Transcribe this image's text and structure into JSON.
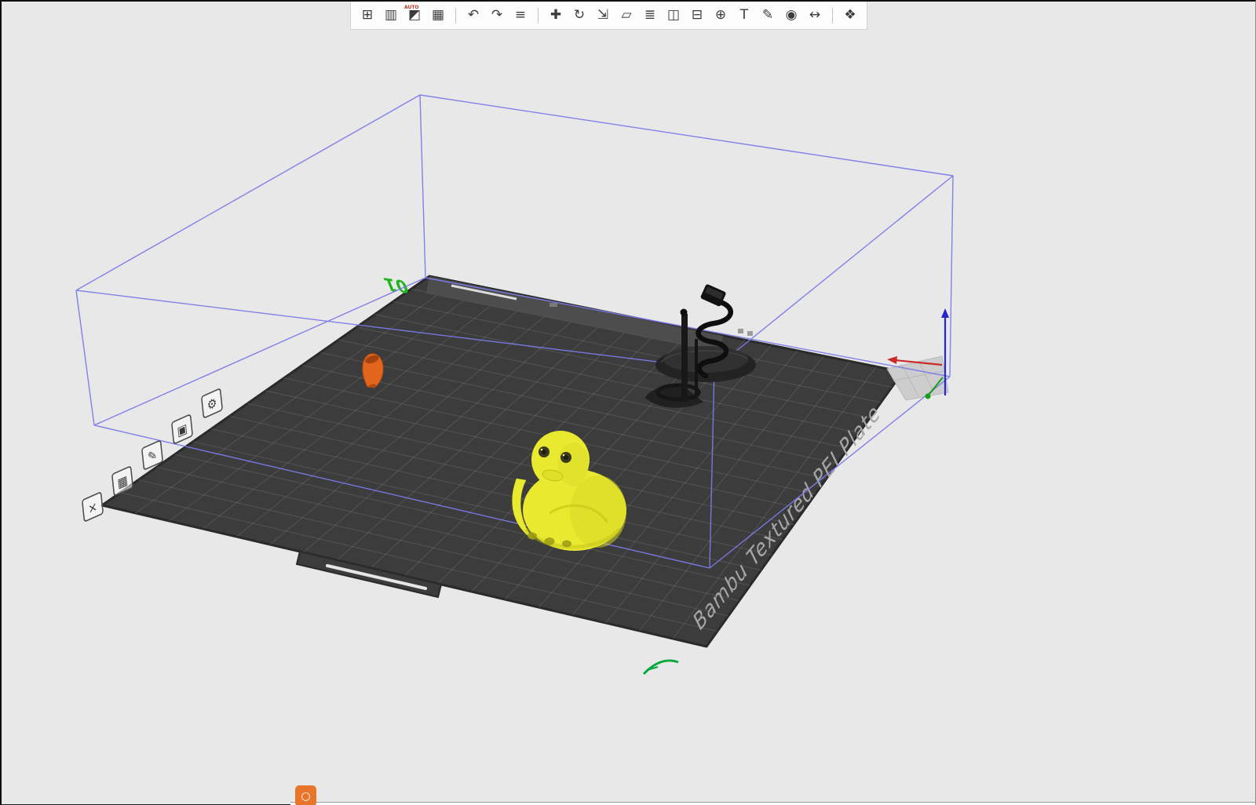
{
  "window": {
    "background": "#e8e8e8",
    "border_color": "#0f0f0f"
  },
  "toolbar": {
    "background": "#fcfcfc",
    "border_color": "#d2d2d2",
    "icon_color": "#3c3c3c",
    "divider_color": "#c4c4c4",
    "groups": [
      {
        "name": "plate-actions",
        "buttons": [
          {
            "name": "add",
            "glyph": "⊞"
          },
          {
            "name": "add-plate",
            "glyph": "▥"
          },
          {
            "name": "auto-orient",
            "glyph": "◩",
            "badge": "AUTO"
          },
          {
            "name": "arrange",
            "glyph": "▦"
          }
        ]
      },
      {
        "name": "history",
        "buttons": [
          {
            "name": "undo",
            "glyph": "↶"
          },
          {
            "name": "redo",
            "glyph": "↷"
          },
          {
            "name": "object-list",
            "glyph": "≡"
          }
        ]
      },
      {
        "name": "object-tools",
        "buttons": [
          {
            "name": "move",
            "glyph": "✚"
          },
          {
            "name": "rotate",
            "glyph": "↻"
          },
          {
            "name": "scale",
            "glyph": "⇲"
          },
          {
            "name": "place-on-face",
            "glyph": "▱"
          },
          {
            "name": "variable-layer-height",
            "glyph": "≣"
          },
          {
            "name": "split-to-objects",
            "glyph": "◫"
          },
          {
            "name": "split-to-parts",
            "glyph": "⊟"
          },
          {
            "name": "mesh-boolean",
            "glyph": "⊕"
          },
          {
            "name": "text",
            "glyph": "T"
          },
          {
            "name": "support-paint",
            "glyph": "✎"
          },
          {
            "name": "seam-paint",
            "glyph": "◉"
          },
          {
            "name": "measure",
            "glyph": "↔"
          }
        ]
      },
      {
        "name": "view",
        "buttons": [
          {
            "name": "assembly-view",
            "glyph": "❖"
          }
        ]
      }
    ]
  },
  "viewport": {
    "plate": {
      "number_label": "01",
      "number_color": "#1eb41e",
      "name_text": "Bambu Textured PEI Plate",
      "name_color": "#a6a6a6",
      "surface_color": "#3c3c3c",
      "edge_color": "#2a2a2a",
      "grid_color": "rgba(170,170,170,0.22)",
      "band_color": "#4f4f4f",
      "handle_slot_color": "#e6e6e6",
      "corner_patch_color": "#cdcdcd",
      "icons": [
        {
          "name": "plate-settings",
          "glyph": "⚙"
        },
        {
          "name": "lock-plate",
          "glyph": "▣"
        },
        {
          "name": "edit-plate-name",
          "glyph": "✎"
        },
        {
          "name": "arrange-plate",
          "glyph": "▦"
        },
        {
          "name": "delete-plate",
          "glyph": "×"
        }
      ]
    },
    "build_volume": {
      "stroke_color": "#7b7bea"
    },
    "axis_indicator": {
      "x_color": "#cc2a2a",
      "y_color": "#17a017",
      "z_color": "#2626cc"
    },
    "models": [
      {
        "name": "rubber-duck",
        "color": "#e9e930"
      },
      {
        "name": "spiral-lamp",
        "color": "#232323"
      },
      {
        "name": "orange-part",
        "color": "#e2651d"
      }
    ],
    "plate_marker_color": "#00a83c"
  },
  "bottom_bar": {
    "strip_color": "#fbfbfb",
    "icon_color": "#e8762a",
    "icon_glyph": "○",
    "line_color": "#1c1c1c"
  }
}
